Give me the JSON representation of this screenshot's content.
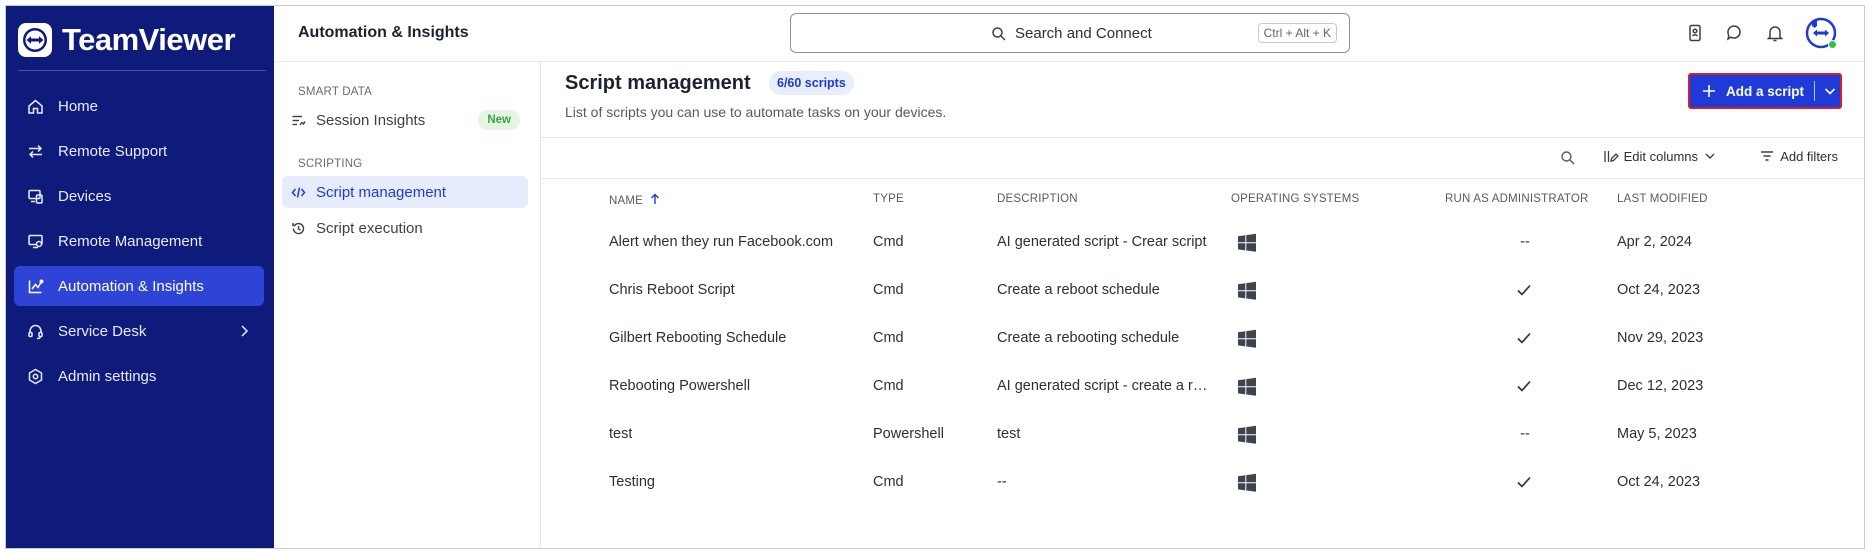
{
  "app": {
    "brand": "TeamViewer"
  },
  "colors": {
    "sidebar_bg": "#0f1b7a",
    "accent": "#1f3ad6",
    "active_nav": "#2d44d6",
    "highlight_border": "#d51e2a",
    "new_badge": "#3aa34a",
    "online": "#2fbf4a"
  },
  "sidebar": {
    "items": [
      {
        "label": "Home",
        "icon": "home-icon"
      },
      {
        "label": "Remote Support",
        "icon": "arrows-swap-icon"
      },
      {
        "label": "Devices",
        "icon": "devices-icon"
      },
      {
        "label": "Remote Management",
        "icon": "monitor-management-icon"
      },
      {
        "label": "Automation & Insights",
        "icon": "automation-icon",
        "active": true
      },
      {
        "label": "Service Desk",
        "icon": "headset-icon",
        "has_chevron": true
      },
      {
        "label": "Admin settings",
        "icon": "settings-shield-icon"
      }
    ]
  },
  "header": {
    "section_title": "Automation & Insights",
    "search": {
      "label": "Search and Connect",
      "shortcut": "Ctrl + Alt + K"
    }
  },
  "subnav": {
    "group1": "SMART DATA",
    "session_insights": "Session Insights",
    "new_badge": "New",
    "group2": "SCRIPTING",
    "script_management": "Script management",
    "script_execution": "Script execution"
  },
  "main": {
    "title": "Script management",
    "count": "6/60 scripts",
    "subtitle": "List of scripts you can use to automate tasks on your devices.",
    "add_button": "Add a script",
    "edit_columns": "Edit columns",
    "add_filters": "Add filters"
  },
  "table": {
    "headers": {
      "name": "NAME",
      "type": "TYPE",
      "description": "DESCRIPTION",
      "os": "OPERATING SYSTEMS",
      "admin": "RUN AS ADMINISTRATOR",
      "modified": "LAST MODIFIED"
    },
    "rows": [
      {
        "name": "Alert when they run Facebook.com",
        "type": "Cmd",
        "description": "AI generated script - Crear script",
        "os": "windows-icon",
        "admin": "--",
        "modified": "Apr 2, 2024"
      },
      {
        "name": "Chris Reboot Script",
        "type": "Cmd",
        "description": "Create a reboot schedule",
        "os": "windows-icon",
        "admin": "check",
        "modified": "Oct 24, 2023"
      },
      {
        "name": "Gilbert Rebooting Schedule",
        "type": "Cmd",
        "description": "Create a rebooting schedule",
        "os": "windows-icon",
        "admin": "check",
        "modified": "Nov 29, 2023"
      },
      {
        "name": "Rebooting Powershell",
        "type": "Cmd",
        "description": "AI generated script - create a reboot",
        "os": "windows-icon",
        "admin": "check",
        "modified": "Dec 12, 2023"
      },
      {
        "name": "test",
        "type": "Powershell",
        "description": "test",
        "os": "windows-icon",
        "admin": "--",
        "modified": "May 5, 2023"
      },
      {
        "name": "Testing",
        "type": "Cmd",
        "description": "--",
        "os": "windows-icon",
        "admin": "check",
        "modified": "Oct 24, 2023"
      }
    ]
  }
}
